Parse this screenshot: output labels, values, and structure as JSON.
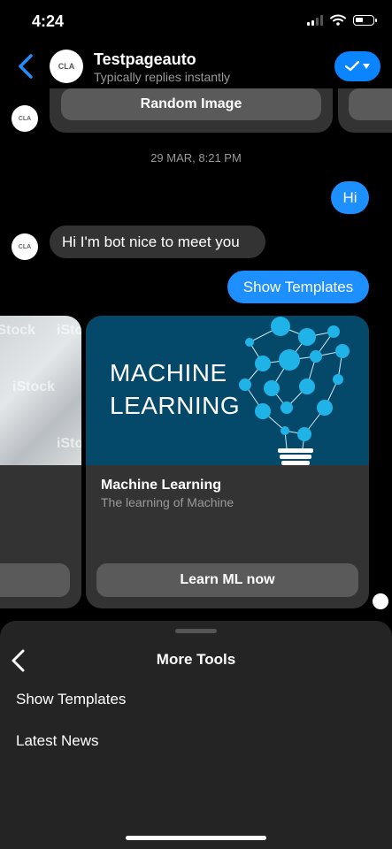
{
  "status": {
    "time": "4:24"
  },
  "header": {
    "title": "Testpageauto",
    "subtitle": "Typically replies instantly",
    "avatar_text": "CLA"
  },
  "messages": {
    "random_image_label": "Random Image",
    "timestamp": "29 MAR, 8:21 PM",
    "user_hi": "Hi",
    "bot_greeting": "Hi I'm bot nice to meet you",
    "user_show_templates": "Show Templates"
  },
  "cards": {
    "left_watermark": "iStock",
    "ml": {
      "image_line1": "MACHINE",
      "image_line2": "LEARNING",
      "title": "Machine Learning",
      "subtitle": "The learning of Machine",
      "button": "Learn ML now"
    }
  },
  "sheet": {
    "title": "More Tools",
    "items": [
      "Show Templates",
      "Latest News"
    ]
  },
  "colors": {
    "accent": "#1e8fff",
    "bubble_bot": "#333333",
    "card_image_bg": "#04486a",
    "bulb": "#1fb3e8"
  }
}
